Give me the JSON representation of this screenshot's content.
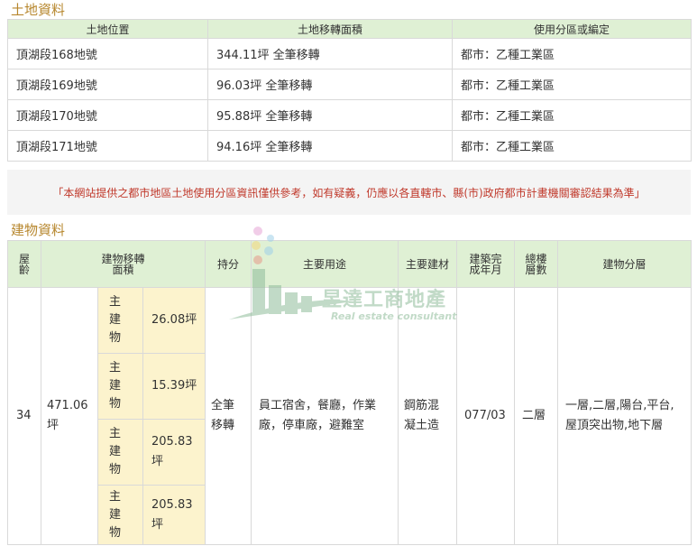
{
  "land": {
    "title": "土地資料",
    "headers": [
      "土地位置",
      "土地移轉面積",
      "使用分區或編定"
    ],
    "rows": [
      {
        "location": "頂湖段168地號",
        "area": "344.11坪 全筆移轉",
        "zoning": "都市：乙種工業區"
      },
      {
        "location": "頂湖段169地號",
        "area": "96.03坪 全筆移轉",
        "zoning": "都市：乙種工業區"
      },
      {
        "location": "頂湖段170地號",
        "area": "95.88坪 全筆移轉",
        "zoning": "都市：乙種工業區"
      },
      {
        "location": "頂湖段171地號",
        "area": "94.16坪 全筆移轉",
        "zoning": "都市：乙種工業區"
      }
    ]
  },
  "notice": "「本網站提供之都市地區土地使用分區資訊僅供參考，如有疑義，仍應以各直轄市、縣(市)政府都市計畫機關審認結果為準」",
  "building": {
    "title": "建物資料",
    "headers": {
      "age": "屋齡",
      "area": "建物移轉面積",
      "share": "持分",
      "use": "主要用途",
      "material": "主要建材",
      "completed": "建築完成年月",
      "floors": "總樓層數",
      "levels": "建物分層"
    },
    "row": {
      "age": "34",
      "total_area": "471.06坪",
      "subs": [
        {
          "label": "主建物",
          "value": "26.08坪"
        },
        {
          "label": "主建物",
          "value": "15.39坪"
        },
        {
          "label": "主建物",
          "value": "205.83坪"
        },
        {
          "label": "主建物",
          "value": "205.83坪"
        }
      ],
      "share": "全筆移轉",
      "use": "員工宿舍，餐廳，作業廠，停車廠，避難室",
      "material": "鋼筋混凝土造",
      "completed": "077/03",
      "floors": "二層",
      "levels": "一層,二層,陽台,平台,屋頂突出物,地下層"
    }
  },
  "watermark": {
    "name": "昱達工商地產",
    "sub": "Real estate consultant"
  },
  "colors": {
    "header_bg": "#dff0d4",
    "title": "#b7872e",
    "notice": "#c0392b",
    "sub_bg": "#fcf3cd"
  }
}
